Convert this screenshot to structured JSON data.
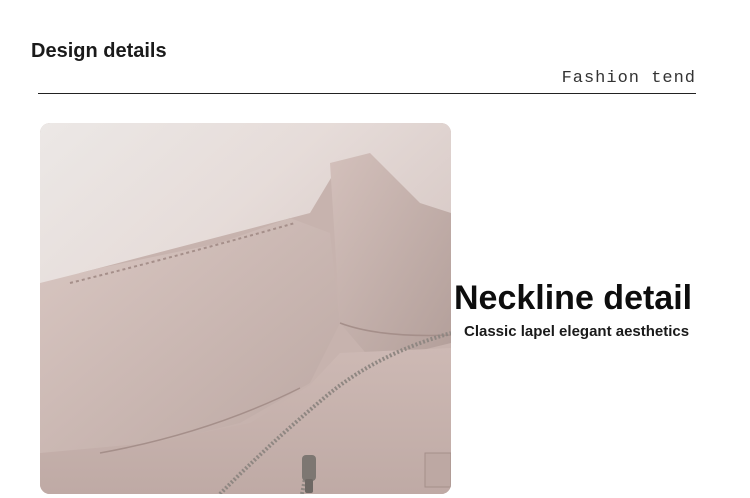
{
  "section": {
    "title": "Design details",
    "subtitle": "Fashion tend"
  },
  "feature": {
    "heading": "Neckline detail",
    "caption": "Classic lapel elegant aesthetics"
  },
  "photo": {
    "subject": "pink jacket collar with zipper close-up",
    "colors": {
      "fabric": "#c8b4b0",
      "fabric_shadow": "#a99590",
      "fabric_light": "#dccbc6",
      "zipper": "#8a8580"
    }
  }
}
